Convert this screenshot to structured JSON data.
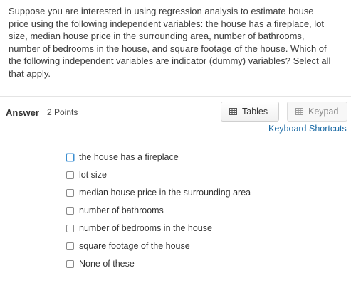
{
  "question": {
    "text": "Suppose you are interested in using regression analysis to estimate house price using the following independent variables: the house has a fireplace, lot size, median house price in the surrounding area, number of bathrooms, number of bedrooms in the house, and square footage of the house. Which of the following independent variables are indicator (dummy) variables? Select all that apply."
  },
  "answer": {
    "label": "Answer",
    "points": "2 Points"
  },
  "toolbar": {
    "tables_label": "Tables",
    "keypad_label": "Keypad",
    "shortcuts_label": "Keyboard Shortcuts",
    "tables_icon": "table-grid-icon",
    "keypad_icon": "keypad-grid-icon"
  },
  "options": [
    {
      "label": "the house has a fireplace",
      "checked": false
    },
    {
      "label": "lot size",
      "checked": false
    },
    {
      "label": "median house price in the surrounding area",
      "checked": false
    },
    {
      "label": "number of bathrooms",
      "checked": false
    },
    {
      "label": "number of bedrooms in the house",
      "checked": false
    },
    {
      "label": "square footage of the house",
      "checked": false
    },
    {
      "label": "None of these",
      "checked": false
    }
  ],
  "colors": {
    "link": "#1a6aa5",
    "focus": "#3a8ed0"
  }
}
